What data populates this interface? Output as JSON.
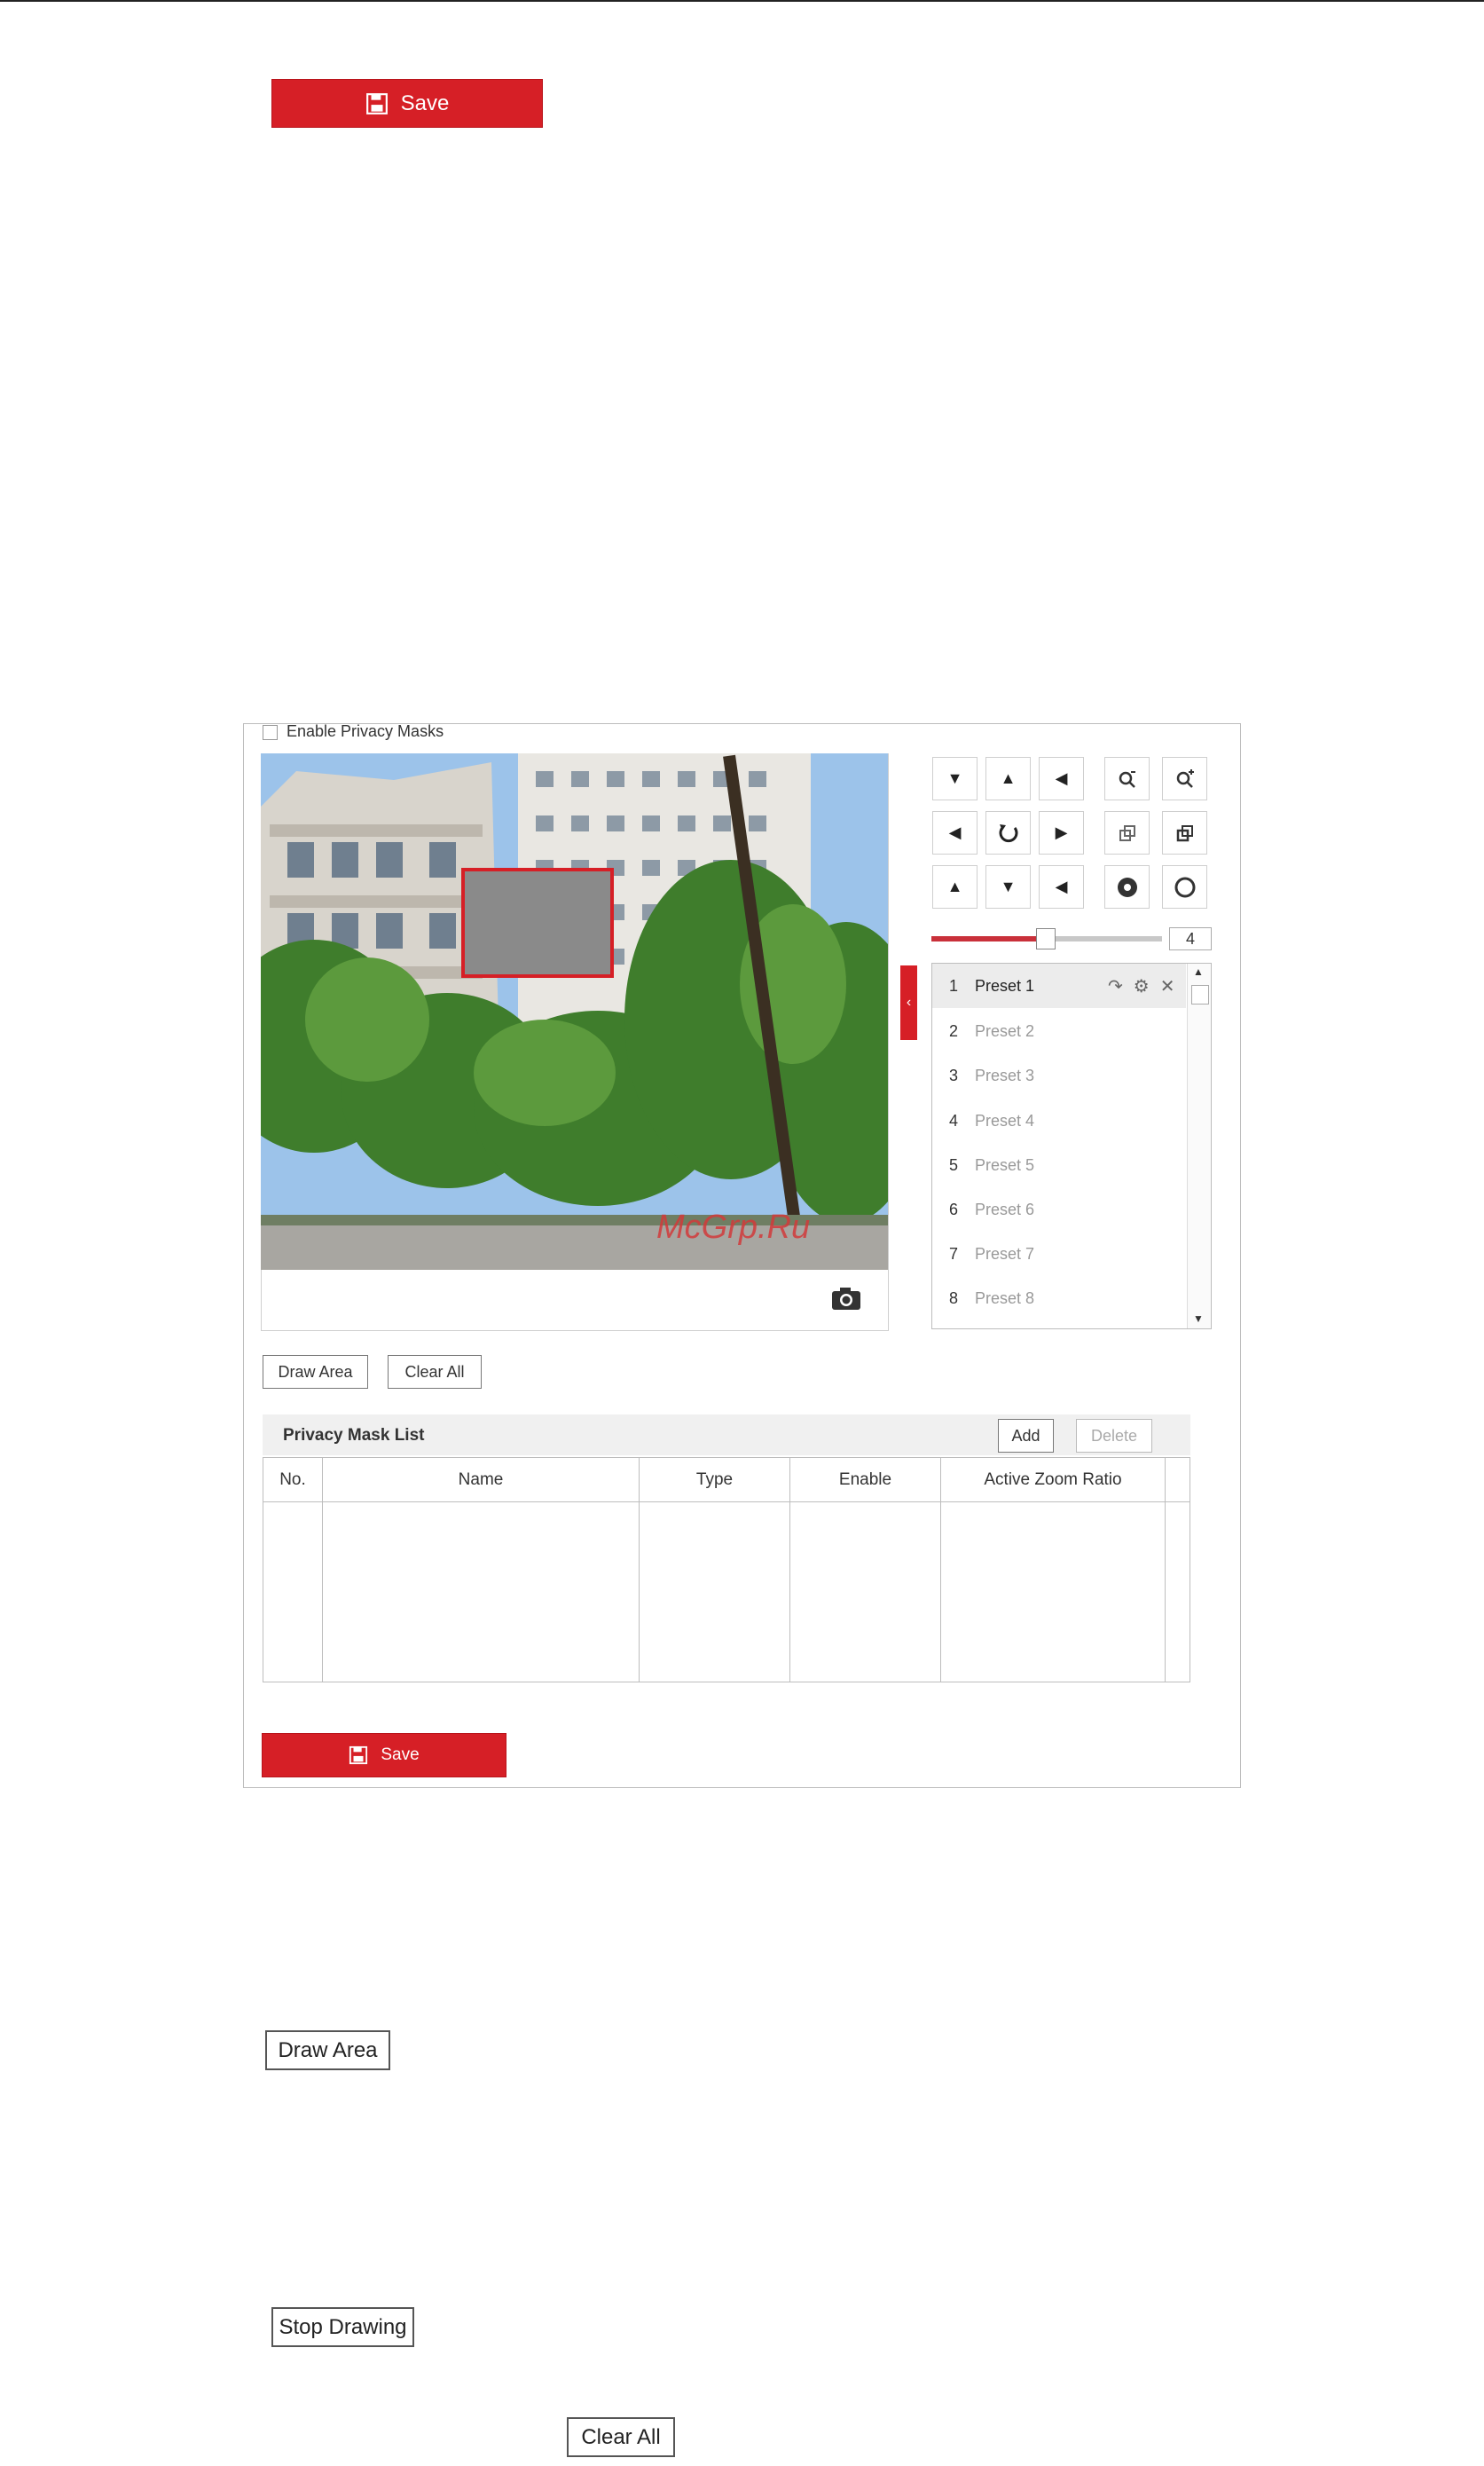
{
  "top_save": {
    "label": "Save"
  },
  "panel": {
    "enable_label": "Enable Privacy Masks",
    "watermark": "McGrp.Ru",
    "speed_value": "4",
    "presets": [
      {
        "num": "1",
        "name": "Preset 1"
      },
      {
        "num": "2",
        "name": "Preset 2"
      },
      {
        "num": "3",
        "name": "Preset 3"
      },
      {
        "num": "4",
        "name": "Preset 4"
      },
      {
        "num": "5",
        "name": "Preset 5"
      },
      {
        "num": "6",
        "name": "Preset 6"
      },
      {
        "num": "7",
        "name": "Preset 7"
      },
      {
        "num": "8",
        "name": "Preset 8"
      }
    ],
    "draw_area_label": "Draw Area",
    "clear_all_label": "Clear All",
    "list_title": "Privacy Mask List",
    "add_label": "Add",
    "delete_label": "Delete",
    "columns": [
      "No.",
      "Name",
      "Type",
      "Enable",
      "Active Zoom Ratio"
    ],
    "save_label": "Save"
  },
  "standalone": {
    "draw_area_label": "Draw Area",
    "stop_drawing_label": "Stop Drawing",
    "clear_all_label": "Clear All"
  },
  "colors": {
    "accent": "#d61f26",
    "mask": "#8a8a8a"
  }
}
